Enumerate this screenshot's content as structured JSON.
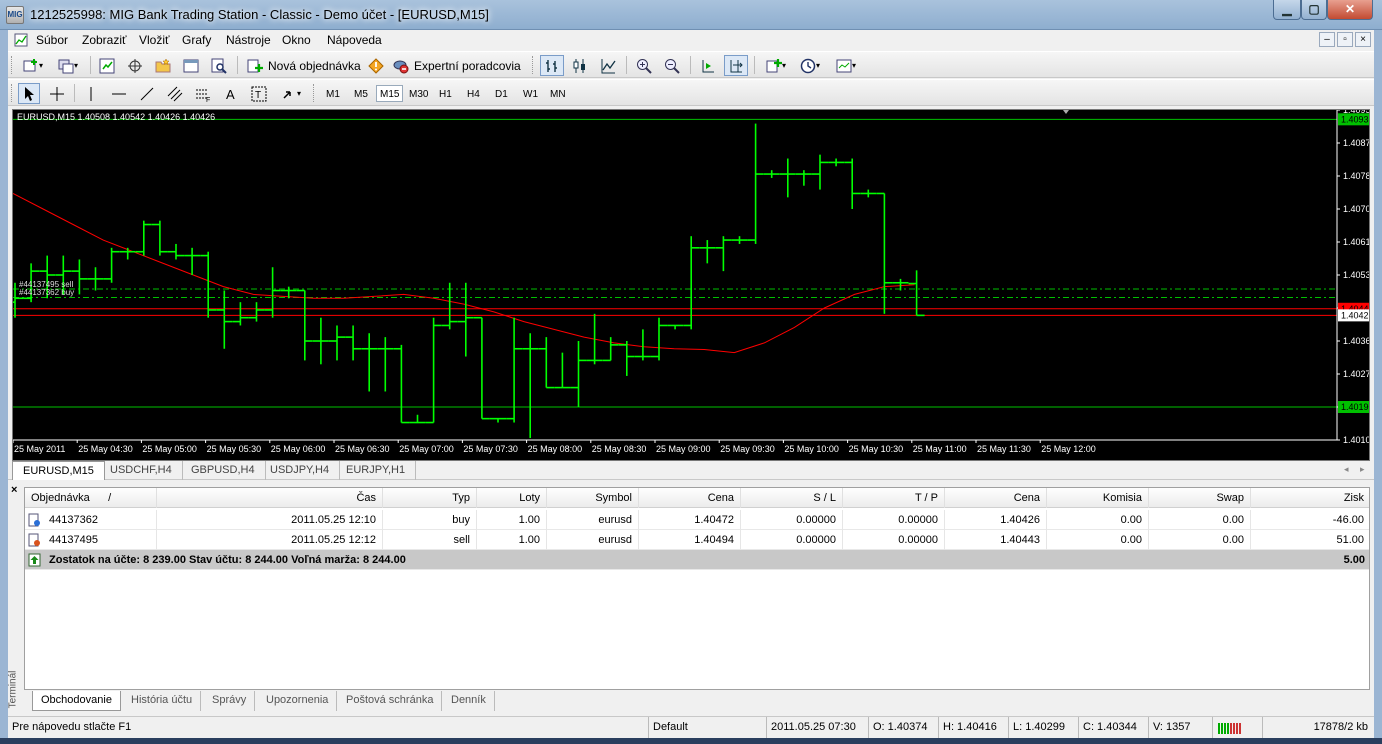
{
  "window": {
    "title": "1212525998: MIG Bank Trading Station - Classic - Demo účet - [EURUSD,M15]",
    "icon_name": "mig-app-icon",
    "min": "▁",
    "max": "▢",
    "close": "✕"
  },
  "menu": {
    "items": [
      "Súbor",
      "Zobraziť",
      "Vložiť",
      "Grafy",
      "Nástroje",
      "Okno",
      "Nápoveda"
    ],
    "mdi": [
      "–",
      "▫",
      "×"
    ]
  },
  "toolbar": {
    "new_order": "Nová objednávka",
    "experts": "Expertní poradcovia"
  },
  "timeframes": {
    "items": [
      "M1",
      "M5",
      "M15",
      "M30",
      "H1",
      "H4",
      "D1",
      "W1",
      "MN"
    ],
    "active": "M15"
  },
  "chart": {
    "header": "EURUSD,M15  1.40508 1.40542 1.40426 1.40426",
    "order_label_sell": "#44137495 sell",
    "order_label_buy": "#44137362 buy",
    "colors": {
      "background": "#000000",
      "bars": "#00ff00",
      "ma": "#ff0000",
      "hline": "#00c000",
      "bid": "#ff0000",
      "order_lines": "#00c000"
    }
  },
  "chart_data": {
    "type": "ohlc",
    "symbol": "EURUSD",
    "timeframe": "M15",
    "ylim": [
      1.40105,
      1.40955
    ],
    "y_ticks": [
      "1.40955",
      "1.40870",
      "1.40785",
      "1.40700",
      "1.40615",
      "1.40530",
      "1.40445",
      "1.40360",
      "1.40275",
      "1.40190",
      "1.40105"
    ],
    "x_ticks": [
      "25 May 2011",
      "25 May 04:30",
      "25 May 05:00",
      "25 May 05:30",
      "25 May 06:00",
      "25 May 06:30",
      "25 May 07:00",
      "25 May 07:30",
      "25 May 08:00",
      "25 May 08:30",
      "25 May 09:00",
      "25 May 09:30",
      "25 May 10:00",
      "25 May 10:30",
      "25 May 11:00",
      "25 May 11:30",
      "25 May 12:00"
    ],
    "price_labels": {
      "upper_line": "1.40931",
      "bid": "1.40426",
      "lower_line": "1.40190",
      "order_tag": "1.40443"
    },
    "levels": {
      "upper_line": 1.40931,
      "lower_line": 1.4019,
      "bid": 1.40426,
      "order_sell": 1.40494,
      "order_buy": 1.40472,
      "marker": 1.40443
    },
    "bars": [
      {
        "o": 1.4046,
        "h": 1.4051,
        "l": 1.4042,
        "c": 1.4047
      },
      {
        "o": 1.4047,
        "h": 1.4056,
        "l": 1.4046,
        "c": 1.4054
      },
      {
        "o": 1.4054,
        "h": 1.4058,
        "l": 1.4047,
        "c": 1.4053
      },
      {
        "o": 1.4053,
        "h": 1.4058,
        "l": 1.4048,
        "c": 1.4054
      },
      {
        "o": 1.4054,
        "h": 1.4057,
        "l": 1.4048,
        "c": 1.4052
      },
      {
        "o": 1.4052,
        "h": 1.4055,
        "l": 1.4049,
        "c": 1.4052
      },
      {
        "o": 1.4052,
        "h": 1.406,
        "l": 1.4051,
        "c": 1.4059
      },
      {
        "o": 1.4059,
        "h": 1.406,
        "l": 1.4057,
        "c": 1.4059
      },
      {
        "o": 1.4059,
        "h": 1.4067,
        "l": 1.4058,
        "c": 1.4066
      },
      {
        "o": 1.4066,
        "h": 1.4067,
        "l": 1.4058,
        "c": 1.4059
      },
      {
        "o": 1.4059,
        "h": 1.4061,
        "l": 1.4057,
        "c": 1.4058
      },
      {
        "o": 1.4058,
        "h": 1.406,
        "l": 1.4053,
        "c": 1.4058
      },
      {
        "o": 1.4058,
        "h": 1.4059,
        "l": 1.4042,
        "c": 1.4044
      },
      {
        "o": 1.4044,
        "h": 1.4049,
        "l": 1.4034,
        "c": 1.4041
      },
      {
        "o": 1.4041,
        "h": 1.4046,
        "l": 1.404,
        "c": 1.4042
      },
      {
        "o": 1.4042,
        "h": 1.4046,
        "l": 1.4041,
        "c": 1.4044
      },
      {
        "o": 1.4044,
        "h": 1.4055,
        "l": 1.4042,
        "c": 1.4049
      },
      {
        "o": 1.4049,
        "h": 1.405,
        "l": 1.4047,
        "c": 1.4049
      },
      {
        "o": 1.4049,
        "h": 1.4049,
        "l": 1.4031,
        "c": 1.4036
      },
      {
        "o": 1.4036,
        "h": 1.4042,
        "l": 1.403,
        "c": 1.4036
      },
      {
        "o": 1.4036,
        "h": 1.404,
        "l": 1.4031,
        "c": 1.4037
      },
      {
        "o": 1.4037,
        "h": 1.404,
        "l": 1.4031,
        "c": 1.4034
      },
      {
        "o": 1.4034,
        "h": 1.4038,
        "l": 1.4023,
        "c": 1.4034
      },
      {
        "o": 1.4034,
        "h": 1.4037,
        "l": 1.4023,
        "c": 1.4034
      },
      {
        "o": 1.4034,
        "h": 1.4035,
        "l": 1.4015,
        "c": 1.4015
      },
      {
        "o": 1.4015,
        "h": 1.4017,
        "l": 1.4015,
        "c": 1.4015
      },
      {
        "o": 1.4015,
        "h": 1.4042,
        "l": 1.4015,
        "c": 1.404
      },
      {
        "o": 1.404,
        "h": 1.4051,
        "l": 1.4039,
        "c": 1.4041
      },
      {
        "o": 1.4041,
        "h": 1.4051,
        "l": 1.4032,
        "c": 1.4042
      },
      {
        "o": 1.4042,
        "h": 1.4042,
        "l": 1.4016,
        "c": 1.4016
      },
      {
        "o": 1.4016,
        "h": 1.4016,
        "l": 1.4015,
        "c": 1.4016
      },
      {
        "o": 1.4016,
        "h": 1.4042,
        "l": 1.4015,
        "c": 1.4034
      },
      {
        "o": 1.4034,
        "h": 1.4038,
        "l": 1.4011,
        "c": 1.4034
      },
      {
        "o": 1.4034,
        "h": 1.4037,
        "l": 1.4024,
        "c": 1.4024
      },
      {
        "o": 1.4024,
        "h": 1.4033,
        "l": 1.4024,
        "c": 1.4024
      },
      {
        "o": 1.4024,
        "h": 1.4036,
        "l": 1.4019,
        "c": 1.4031
      },
      {
        "o": 1.4031,
        "h": 1.4043,
        "l": 1.403,
        "c": 1.4031
      },
      {
        "o": 1.4031,
        "h": 1.4037,
        "l": 1.4031,
        "c": 1.4035
      },
      {
        "o": 1.4035,
        "h": 1.4036,
        "l": 1.4027,
        "c": 1.4032
      },
      {
        "o": 1.4032,
        "h": 1.4039,
        "l": 1.4031,
        "c": 1.4032
      },
      {
        "o": 1.4032,
        "h": 1.4042,
        "l": 1.4031,
        "c": 1.404
      },
      {
        "o": 1.404,
        "h": 1.404,
        "l": 1.4039,
        "c": 1.404
      },
      {
        "o": 1.404,
        "h": 1.4063,
        "l": 1.4039,
        "c": 1.406
      },
      {
        "o": 1.406,
        "h": 1.4062,
        "l": 1.4056,
        "c": 1.406
      },
      {
        "o": 1.406,
        "h": 1.4063,
        "l": 1.4054,
        "c": 1.4062
      },
      {
        "o": 1.4062,
        "h": 1.4063,
        "l": 1.4061,
        "c": 1.4062
      },
      {
        "o": 1.4062,
        "h": 1.4092,
        "l": 1.4061,
        "c": 1.4079
      },
      {
        "o": 1.4079,
        "h": 1.408,
        "l": 1.4078,
        "c": 1.4079
      },
      {
        "o": 1.4079,
        "h": 1.4083,
        "l": 1.4073,
        "c": 1.4079
      },
      {
        "o": 1.4079,
        "h": 1.408,
        "l": 1.4076,
        "c": 1.4079
      },
      {
        "o": 1.4079,
        "h": 1.4084,
        "l": 1.4075,
        "c": 1.4082
      },
      {
        "o": 1.4082,
        "h": 1.4083,
        "l": 1.4081,
        "c": 1.4082
      },
      {
        "o": 1.4082,
        "h": 1.4083,
        "l": 1.407,
        "c": 1.4074
      },
      {
        "o": 1.4074,
        "h": 1.4075,
        "l": 1.4073,
        "c": 1.4074
      },
      {
        "o": 1.4074,
        "h": 1.4074,
        "l": 1.4043,
        "c": 1.4051
      },
      {
        "o": 1.4051,
        "h": 1.4052,
        "l": 1.4049,
        "c": 1.4051
      },
      {
        "o": 1.40508,
        "h": 1.40542,
        "l": 1.40426,
        "c": 1.40426
      }
    ],
    "ma": [
      1.4074,
      1.407,
      1.4066,
      1.4062,
      1.4059,
      1.4056,
      1.4053,
      1.405,
      1.4048,
      1.40475,
      1.4047,
      1.4047,
      1.40475,
      1.4048,
      1.4047,
      1.40455,
      1.40435,
      1.4041,
      1.4039,
      1.4037,
      1.40355,
      1.40345,
      1.4034,
      1.40338,
      1.4033,
      1.40355,
      1.40395,
      1.40445,
      1.4048,
      1.405,
      1.40505
    ]
  },
  "chart_tabs": {
    "items": [
      "EURUSD,M15",
      "USDCHF,H4",
      "GBPUSD,H4",
      "USDJPY,H4",
      "EURJPY,H1"
    ],
    "active": "EURUSD,M15",
    "left": "◂",
    "right": "▸"
  },
  "terminal": {
    "close": "×",
    "side_label": "Terminál",
    "columns": [
      "Objednávka",
      "Čas",
      "Typ",
      "Loty",
      "Symbol",
      "Cena",
      "S / L",
      "T / P",
      "Cena",
      "Komisia",
      "Swap",
      "Zisk"
    ],
    "sort_marker": "/",
    "rows": [
      [
        "44137362",
        "2011.05.25 12:10",
        "buy",
        "1.00",
        "eurusd",
        "1.40472",
        "0.00000",
        "0.00000",
        "1.40426",
        "0.00",
        "0.00",
        "-46.00"
      ],
      [
        "44137495",
        "2011.05.25 12:12",
        "sell",
        "1.00",
        "eurusd",
        "1.40494",
        "0.00000",
        "0.00000",
        "1.40443",
        "0.00",
        "0.00",
        "51.00"
      ]
    ],
    "summary_text": "Zostatok na účte: 8 239.00  Stav účtu: 8 244.00  Voľná marža: 8 244.00",
    "summary_profit": "5.00",
    "tabs": [
      "Obchodovanie",
      "História účtu",
      "Správy",
      "Upozornenia",
      "Poštová schránka",
      "Denník"
    ],
    "active_tab": "Obchodovanie"
  },
  "statusbar": {
    "help": "Pre nápovedu stlačte F1",
    "profile": "Default",
    "time": "2011.05.25 07:30",
    "open": "O: 1.40374",
    "high": "H: 1.40416",
    "low": "L: 1.40299",
    "close": "C: 1.40344",
    "volume": "V: 1357",
    "traffic": "17878/2 kb"
  }
}
